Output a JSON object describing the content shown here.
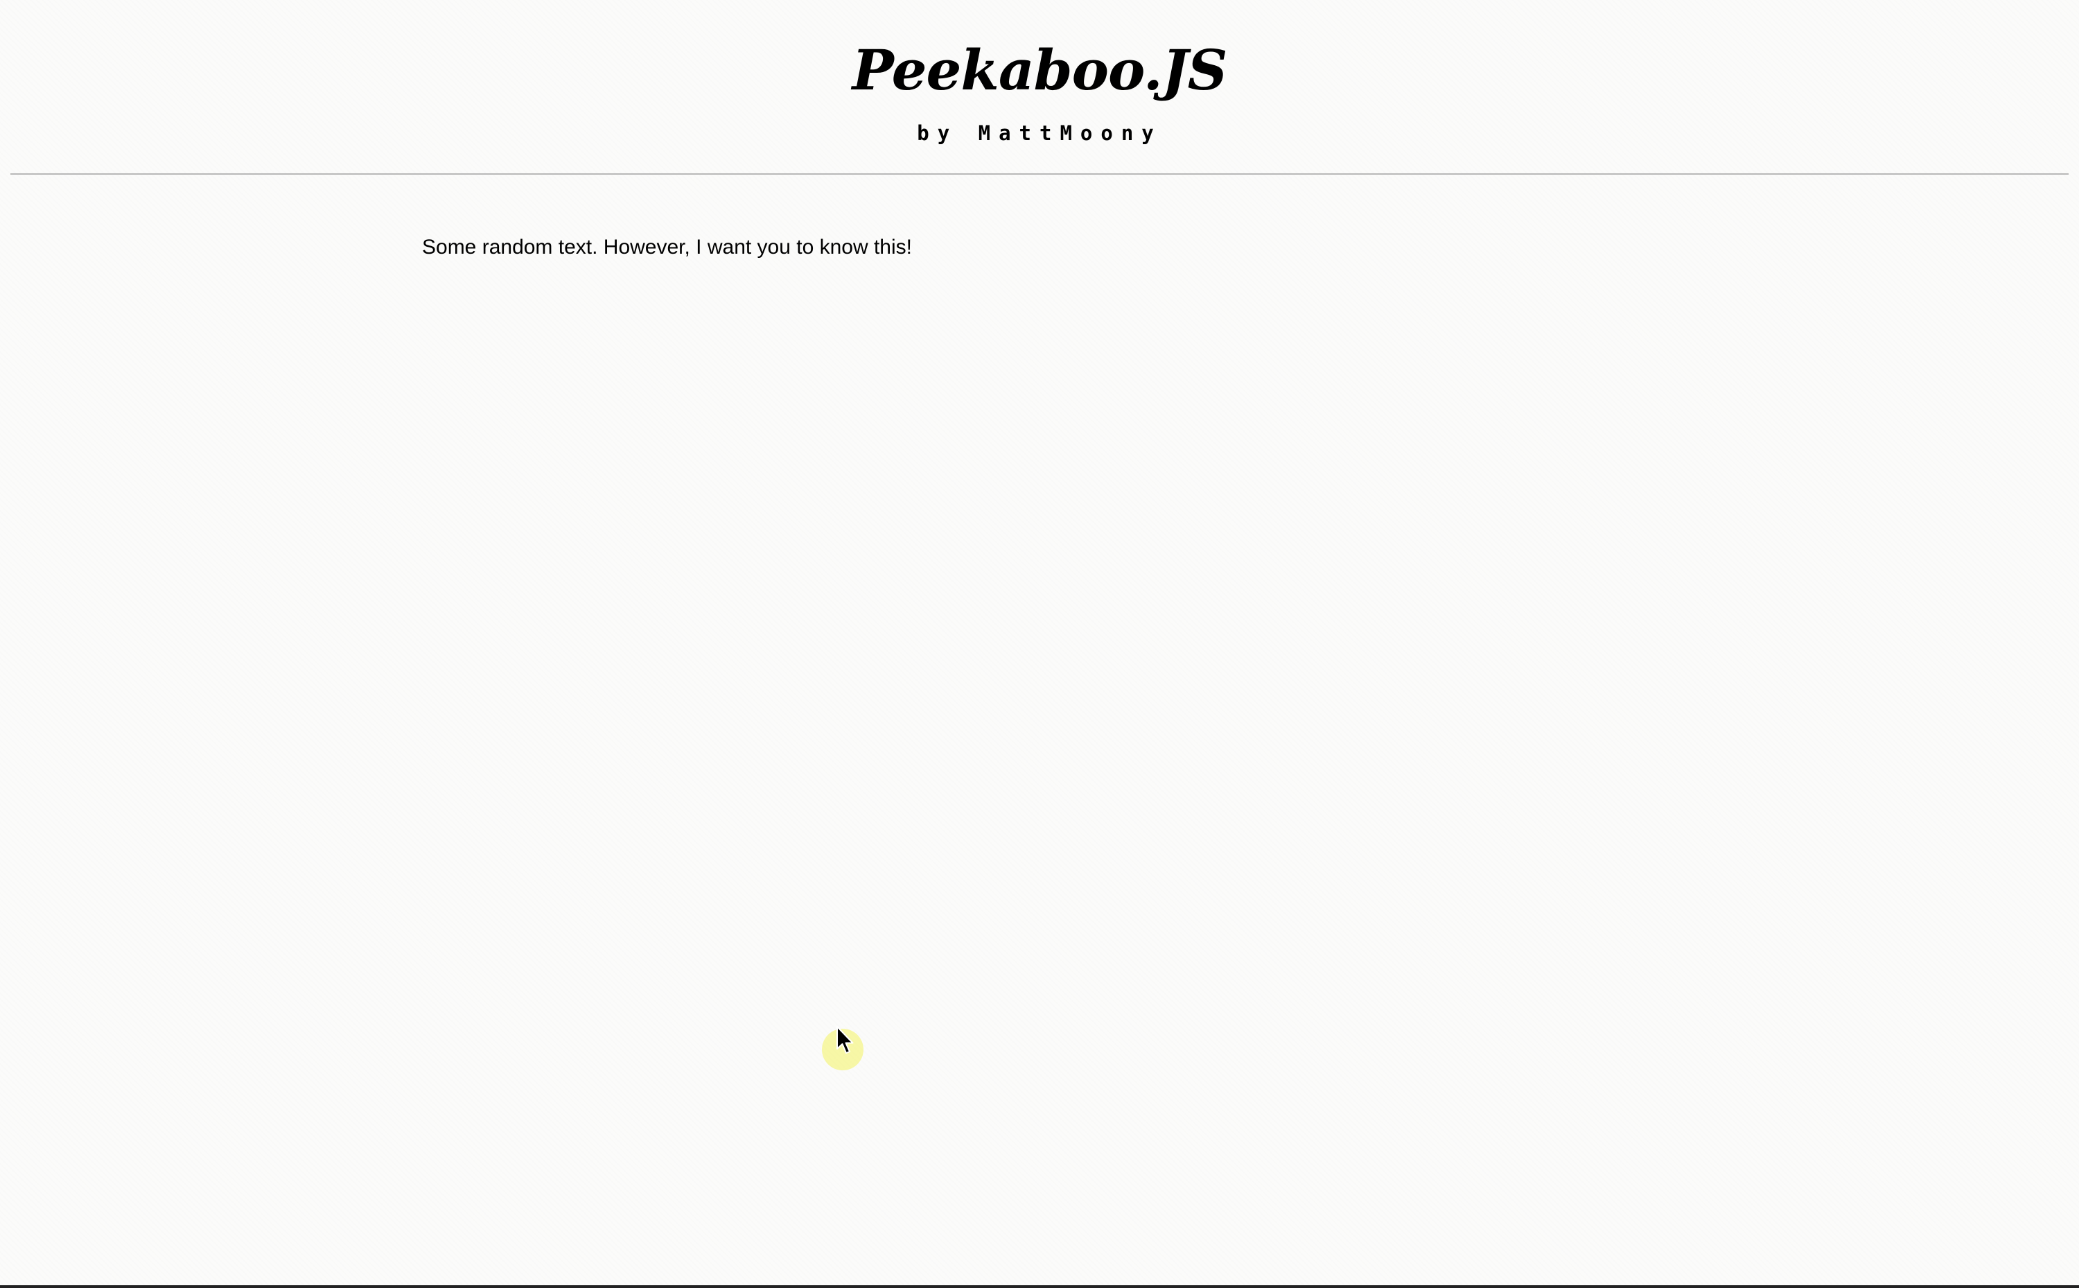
{
  "header": {
    "title": "Peekaboo.JS",
    "subtitle": "by MattMoony"
  },
  "main": {
    "text": "Some random text. However, I want you to know this!"
  },
  "cursor": {
    "icon": "mouse-pointer-icon",
    "highlight_color": "#f6f696"
  },
  "colors": {
    "background": "#fbfbfa",
    "divider": "#b8b8b8",
    "text": "#000000"
  }
}
